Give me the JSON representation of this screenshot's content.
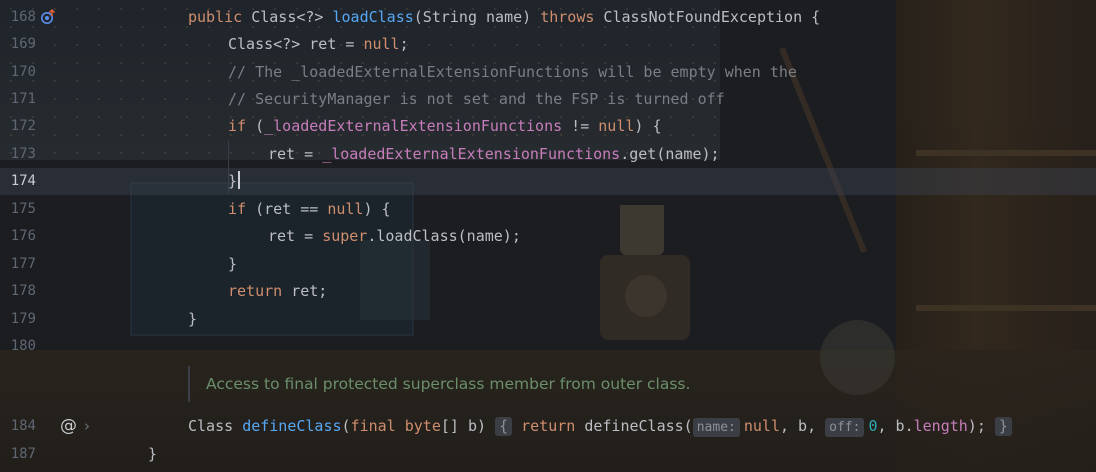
{
  "colors": {
    "keyword": "#cf8e6d",
    "method": "#56a8f5",
    "comment": "#7a7e85",
    "field": "#c77dbb",
    "number": "#2aacb8",
    "text": "#bcbec4",
    "doc_hint": "#6b8f6b"
  },
  "gutter": {
    "override_icon": "override-up-arrow-icon",
    "line_numbers": [
      "168",
      "169",
      "170",
      "171",
      "172",
      "173",
      "174",
      "175",
      "176",
      "177",
      "178",
      "179",
      "180",
      "184",
      "187"
    ],
    "current_line": "174",
    "annotation_icon": "@",
    "expand_icon": "›"
  },
  "code": {
    "l168": {
      "kw1": "public",
      "t1": " Class<?> ",
      "fn": "loadClass",
      "t2": "(String name) ",
      "kw2": "throws",
      "t3": " ClassNotFoundException {"
    },
    "l169": {
      "t1": "Class<?> ret = ",
      "kw": "null",
      "t2": ";"
    },
    "l170": {
      "cm": "// The _loadedExternalExtensionFunctions will be empty when the"
    },
    "l171": {
      "cm": "// SecurityManager is not set and the FSP is turned off"
    },
    "l172": {
      "kw1": "if",
      "t1": " (",
      "fld": "_loadedExternalExtensionFunctions",
      "t2": " != ",
      "kw2": "null",
      "t3": ") {"
    },
    "l173": {
      "t1": "ret = ",
      "fld": "_loadedExternalExtensionFunctions",
      "t2": ".get(name);"
    },
    "l174": {
      "t1": "}"
    },
    "l175": {
      "kw1": "if",
      "t1": " (ret == ",
      "kw2": "null",
      "t2": ") {"
    },
    "l176": {
      "t1": "ret = ",
      "kw": "super",
      "t2": ".loadClass(name);"
    },
    "l177": {
      "t1": "}"
    },
    "l178": {
      "kw": "return",
      "t1": " ret;"
    },
    "l179": {
      "t1": "}"
    },
    "l184": {
      "t1": "Class ",
      "fn": "defineClass",
      "t2": "(",
      "kw1": "final",
      "t3": " ",
      "kw2": "byte",
      "t4": "[] b) ",
      "fold_open": "{",
      "kw3": "return",
      "t5": " defineClass(",
      "hint1": "name:",
      "kw4": "null",
      "t6": ", b, ",
      "hint2": "off:",
      "num": "0",
      "t7": ", b.",
      "fld": "length",
      "t8": "); ",
      "fold_close": "}"
    },
    "l187": {
      "t1": "}"
    }
  },
  "doc_comment": "Access to final protected superclass member from outer class."
}
